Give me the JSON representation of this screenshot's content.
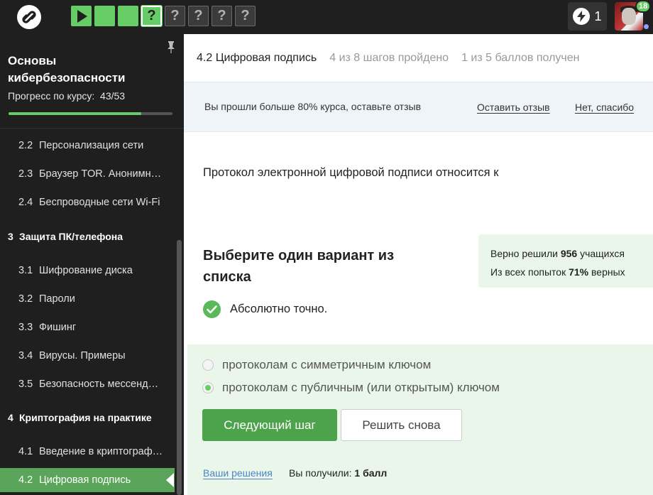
{
  "topbar": {
    "steps": [
      {
        "state": "done",
        "icon": "play-icon"
      },
      {
        "state": "done",
        "label": ""
      },
      {
        "state": "done",
        "label": ""
      },
      {
        "state": "current",
        "label": "?"
      },
      {
        "state": "todo",
        "label": "?"
      },
      {
        "state": "todo",
        "label": "?"
      },
      {
        "state": "todo",
        "label": "?"
      },
      {
        "state": "todo",
        "label": "?"
      }
    ],
    "energy_count": "1",
    "notification_count": "18"
  },
  "sidebar": {
    "course_title": "Основы кибербезопасности",
    "progress_label": "Прогресс по курсу:",
    "progress_value": "43/53",
    "progress_fraction": 0.811,
    "items": [
      {
        "type": "lesson",
        "num": "2.2",
        "title": "Персонализация сети"
      },
      {
        "type": "lesson",
        "num": "2.3",
        "title": "Браузер TOR. Анонимность"
      },
      {
        "type": "lesson",
        "num": "2.4",
        "title": "Беспроводные сети Wi-Fi"
      },
      {
        "type": "section",
        "num": "3",
        "title": "Защита ПК/телефона"
      },
      {
        "type": "lesson",
        "num": "3.1",
        "title": "Шифрование диска"
      },
      {
        "type": "lesson",
        "num": "3.2",
        "title": "Пароли"
      },
      {
        "type": "lesson",
        "num": "3.3",
        "title": "Фишинг"
      },
      {
        "type": "lesson",
        "num": "3.4",
        "title": "Вирусы. Примеры"
      },
      {
        "type": "lesson",
        "num": "3.5",
        "title": "Безопасность мессенджеров"
      },
      {
        "type": "section",
        "num": "4",
        "title": "Криптография на практике"
      },
      {
        "type": "lesson",
        "num": "4.1",
        "title": "Введение в криптографию"
      },
      {
        "type": "lesson",
        "num": "4.2",
        "title": "Цифровая подпись",
        "active": true
      }
    ]
  },
  "header": {
    "step_title": "4.2 Цифровая подпись",
    "steps_passed": "4 из 8 шагов пройдено",
    "score": "1 из 5 баллов  получен"
  },
  "review_banner": {
    "text": "Вы прошли больше 80% курса, оставьте отзыв",
    "leave_review": "Оставить отзыв",
    "decline": "Нет, спасибо"
  },
  "question": {
    "text": "Протокол электронной цифровой подписи относится к",
    "task_heading": "Выберите один вариант из списка",
    "result_text": "Абсолютно точно."
  },
  "stats": {
    "solved_prefix": "Верно решили",
    "solved_count": "956",
    "solved_suffix": "учащихся",
    "attempts_prefix": "Из всех попыток",
    "attempts_percent": "71%",
    "attempts_suffix": "верных"
  },
  "answers": {
    "options": [
      {
        "label": "протоколам с симметричным ключом",
        "selected": false
      },
      {
        "label": "протоколам с публичным (или открытым) ключом",
        "selected": true
      }
    ],
    "next_label": "Следующий шаг",
    "retry_label": "Решить снова",
    "solutions_link": "Ваши решения",
    "received_label": "Вы получили:",
    "received_value": "1 балл"
  },
  "colors": {
    "accent_green": "#66cc66",
    "button_green": "#4ca34c",
    "dark_bg": "#1f1f1f",
    "link_blue": "#4a84c9"
  }
}
